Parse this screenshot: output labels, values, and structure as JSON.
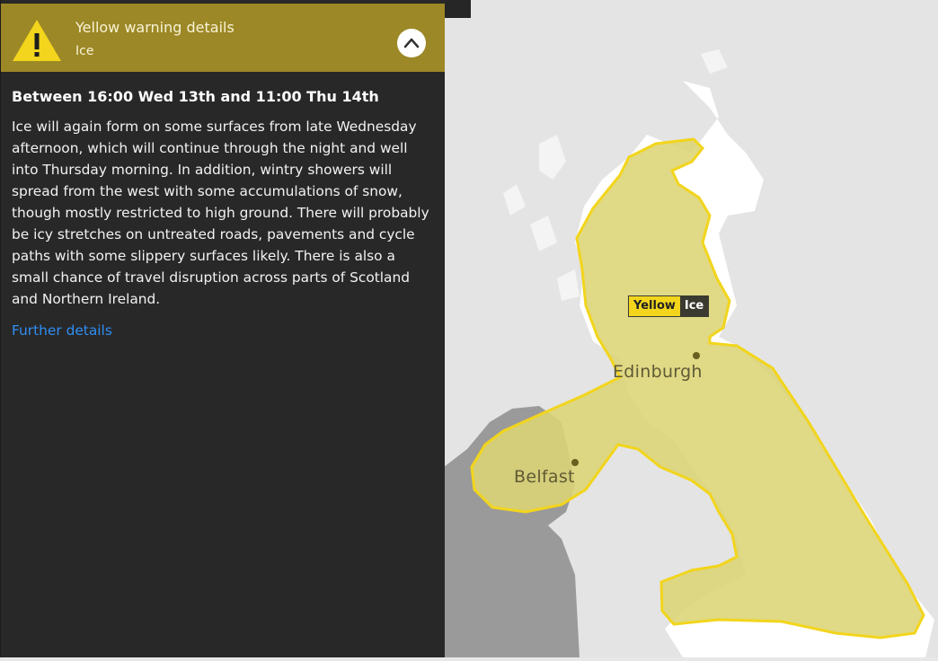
{
  "warning": {
    "title": "Yellow warning details",
    "type": "Ice",
    "period": "Between 16:00 Wed 13th and 11:00 Thu 14th",
    "description": "Ice will again form on some surfaces from late Wednesday afternoon, which will continue through the night and well into Thursday morning. In addition, wintry showers will spread from the west with some accumulations of snow, though mostly restricted to high ground. There will probably be icy stretches on untreated roads, pavements and cycle paths with some slippery surfaces likely. There is also a small chance of travel disruption across parts of Scotland and Northern Ireland.",
    "further_link": "Further details"
  },
  "map": {
    "warning_label": {
      "level": "Yellow",
      "type": "Ice"
    },
    "cities": [
      {
        "name": "Edinburgh"
      },
      {
        "name": "Belfast"
      }
    ]
  },
  "colors": {
    "header": "#9c8826",
    "warning_area": "#dcd474",
    "warning_border": "#f2d51c",
    "panel": "#282828",
    "link": "#2f8ff5"
  },
  "icons": [
    "warning-triangle-icon",
    "chevron-up-icon"
  ]
}
